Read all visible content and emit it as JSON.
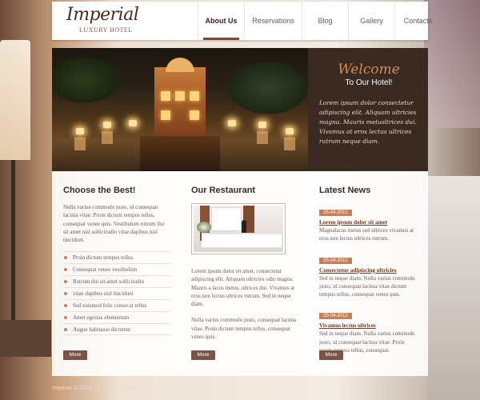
{
  "logo": {
    "name": "Imperial",
    "tagline": "LUXURY HOTEL"
  },
  "nav": {
    "items": [
      "About Us",
      "Reservations",
      "Blog",
      "Gallery",
      "Contacts"
    ],
    "active": "About Us"
  },
  "welcome": {
    "title": "Welcome",
    "subtitle": "To Our Hotel!",
    "text": "Lorem ipsum dolor consectetur adipiscing elit. Aliquam ultricies magna. Mauris metusltrices dui. Vivamus at eros lectus ultrices rutrum neque diam."
  },
  "choose": {
    "title": "Choose the Best!",
    "text": "Nulla varius commodo justo, id consequat lacinia vitae. Proin dictum tempus tellus, consequat venee quis. Vestibulum rutrum dui sit amet nisl sollicitudin vitae dapibus nisl tincidunt.",
    "bullets": [
      "Proin dictum tempus tellus",
      "Consequat venes vestibulum",
      "Rutrum dui sit amet sollicitudin",
      "vitae dapibus nisl tincidunt",
      "Sed euismod felis consecat tellus",
      "Amet egestas elementum",
      "Augue habitasse dictumst"
    ],
    "button": "More"
  },
  "restaurant": {
    "title": "Our Restaurant",
    "text1": "Lorem ipsum dolor sit amet, consectetur adipiscing elit. Aliquam ultricies odio magna. Mauris a lacus metus, ultrices dui. Vivamus at eros non lectus ultrices rutrum. Sed in neque diam.",
    "text2": "Nulla varius commodo justo, consequat lacinia vitae. Proin dictum tempus tellus, consequat venes quis.",
    "button": "More"
  },
  "news": {
    "title": "Latest News",
    "items": [
      {
        "date": "25-04-2012",
        "title": "Lorem ipsum dolor sit amet",
        "text": "Magnalacus metus sed ultrices vivamus at eros non lectus ultrices rutrum."
      },
      {
        "date": "25-04-2012",
        "title": "Consectetur adipiscing ultricies",
        "text": "Sed in neque diam. Nulla varius commodo justo, id consequat lacinia vitae dictum tempus tellus, consequat venes quis."
      },
      {
        "date": "25-04-2012",
        "title": "Vivamus lectus ultrices",
        "text": "Sed in neque diam. Nulla varius commodo justo, id consequat lacinia vitae. Proin ictum tempus tellus, consequat."
      }
    ],
    "button": "More"
  },
  "footer": {
    "copyright": "Imperial © 2012",
    "separator": "|",
    "privacy": "Privacy Policy"
  },
  "colors": {
    "brand_dark": "#3b2a22",
    "accent": "#c48058",
    "button": "#7a5446"
  }
}
